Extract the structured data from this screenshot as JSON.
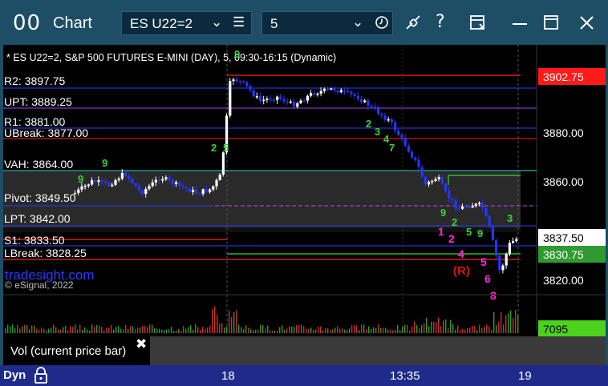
{
  "window": {
    "app_icon": "00",
    "title": "Chart",
    "symbol": "ES U22=2",
    "interval": "5"
  },
  "chart": {
    "header": "* ES U22=2, S&P 500 FUTURES E-MINI (DAY), 5, 09:30-16:15 (Dynamic)",
    "watermark": "tradesight.com",
    "copyright": "© eSignal, 2022",
    "level_labels": [
      "R2: 3897.75",
      "UPT: 3889.25",
      "R1: 3881.00",
      "UBreak: 3877.00",
      "VAH: 3864.00",
      "Pivot: 3849.50",
      "LPT: 3842.00",
      "S1: 3833.50",
      "LBreak: 3828.25"
    ],
    "price_axis": [
      "3880.00",
      "3860.00",
      "3820.00"
    ],
    "price_badges": {
      "upper": "3902.75",
      "last": "3837.50",
      "lower": "3830.75"
    },
    "volume_badge": "7095",
    "annotations": {
      "td_green": [
        "9",
        "9",
        "2",
        "5",
        "9",
        "2",
        "3",
        "4",
        "7",
        "9",
        "2",
        "5",
        "9",
        "3"
      ],
      "td_magenta": [
        "1",
        "2",
        "4",
        "5",
        "6",
        "8"
      ],
      "r_marker": "(R)"
    },
    "colors": {
      "background": "#000000",
      "candle_up": "#ffffff",
      "candle_down": "#2435ff",
      "red": "#ff2020",
      "green": "#3bd13b",
      "magenta": "#ff2bd6",
      "cyan": "#3ee0e0"
    }
  },
  "volume_panel": {
    "label": "Vol (current price bar)",
    "close_icon": "✖"
  },
  "time_axis": {
    "dyn": "Dyn",
    "labels": [
      "18",
      "13:35",
      "19"
    ]
  }
}
